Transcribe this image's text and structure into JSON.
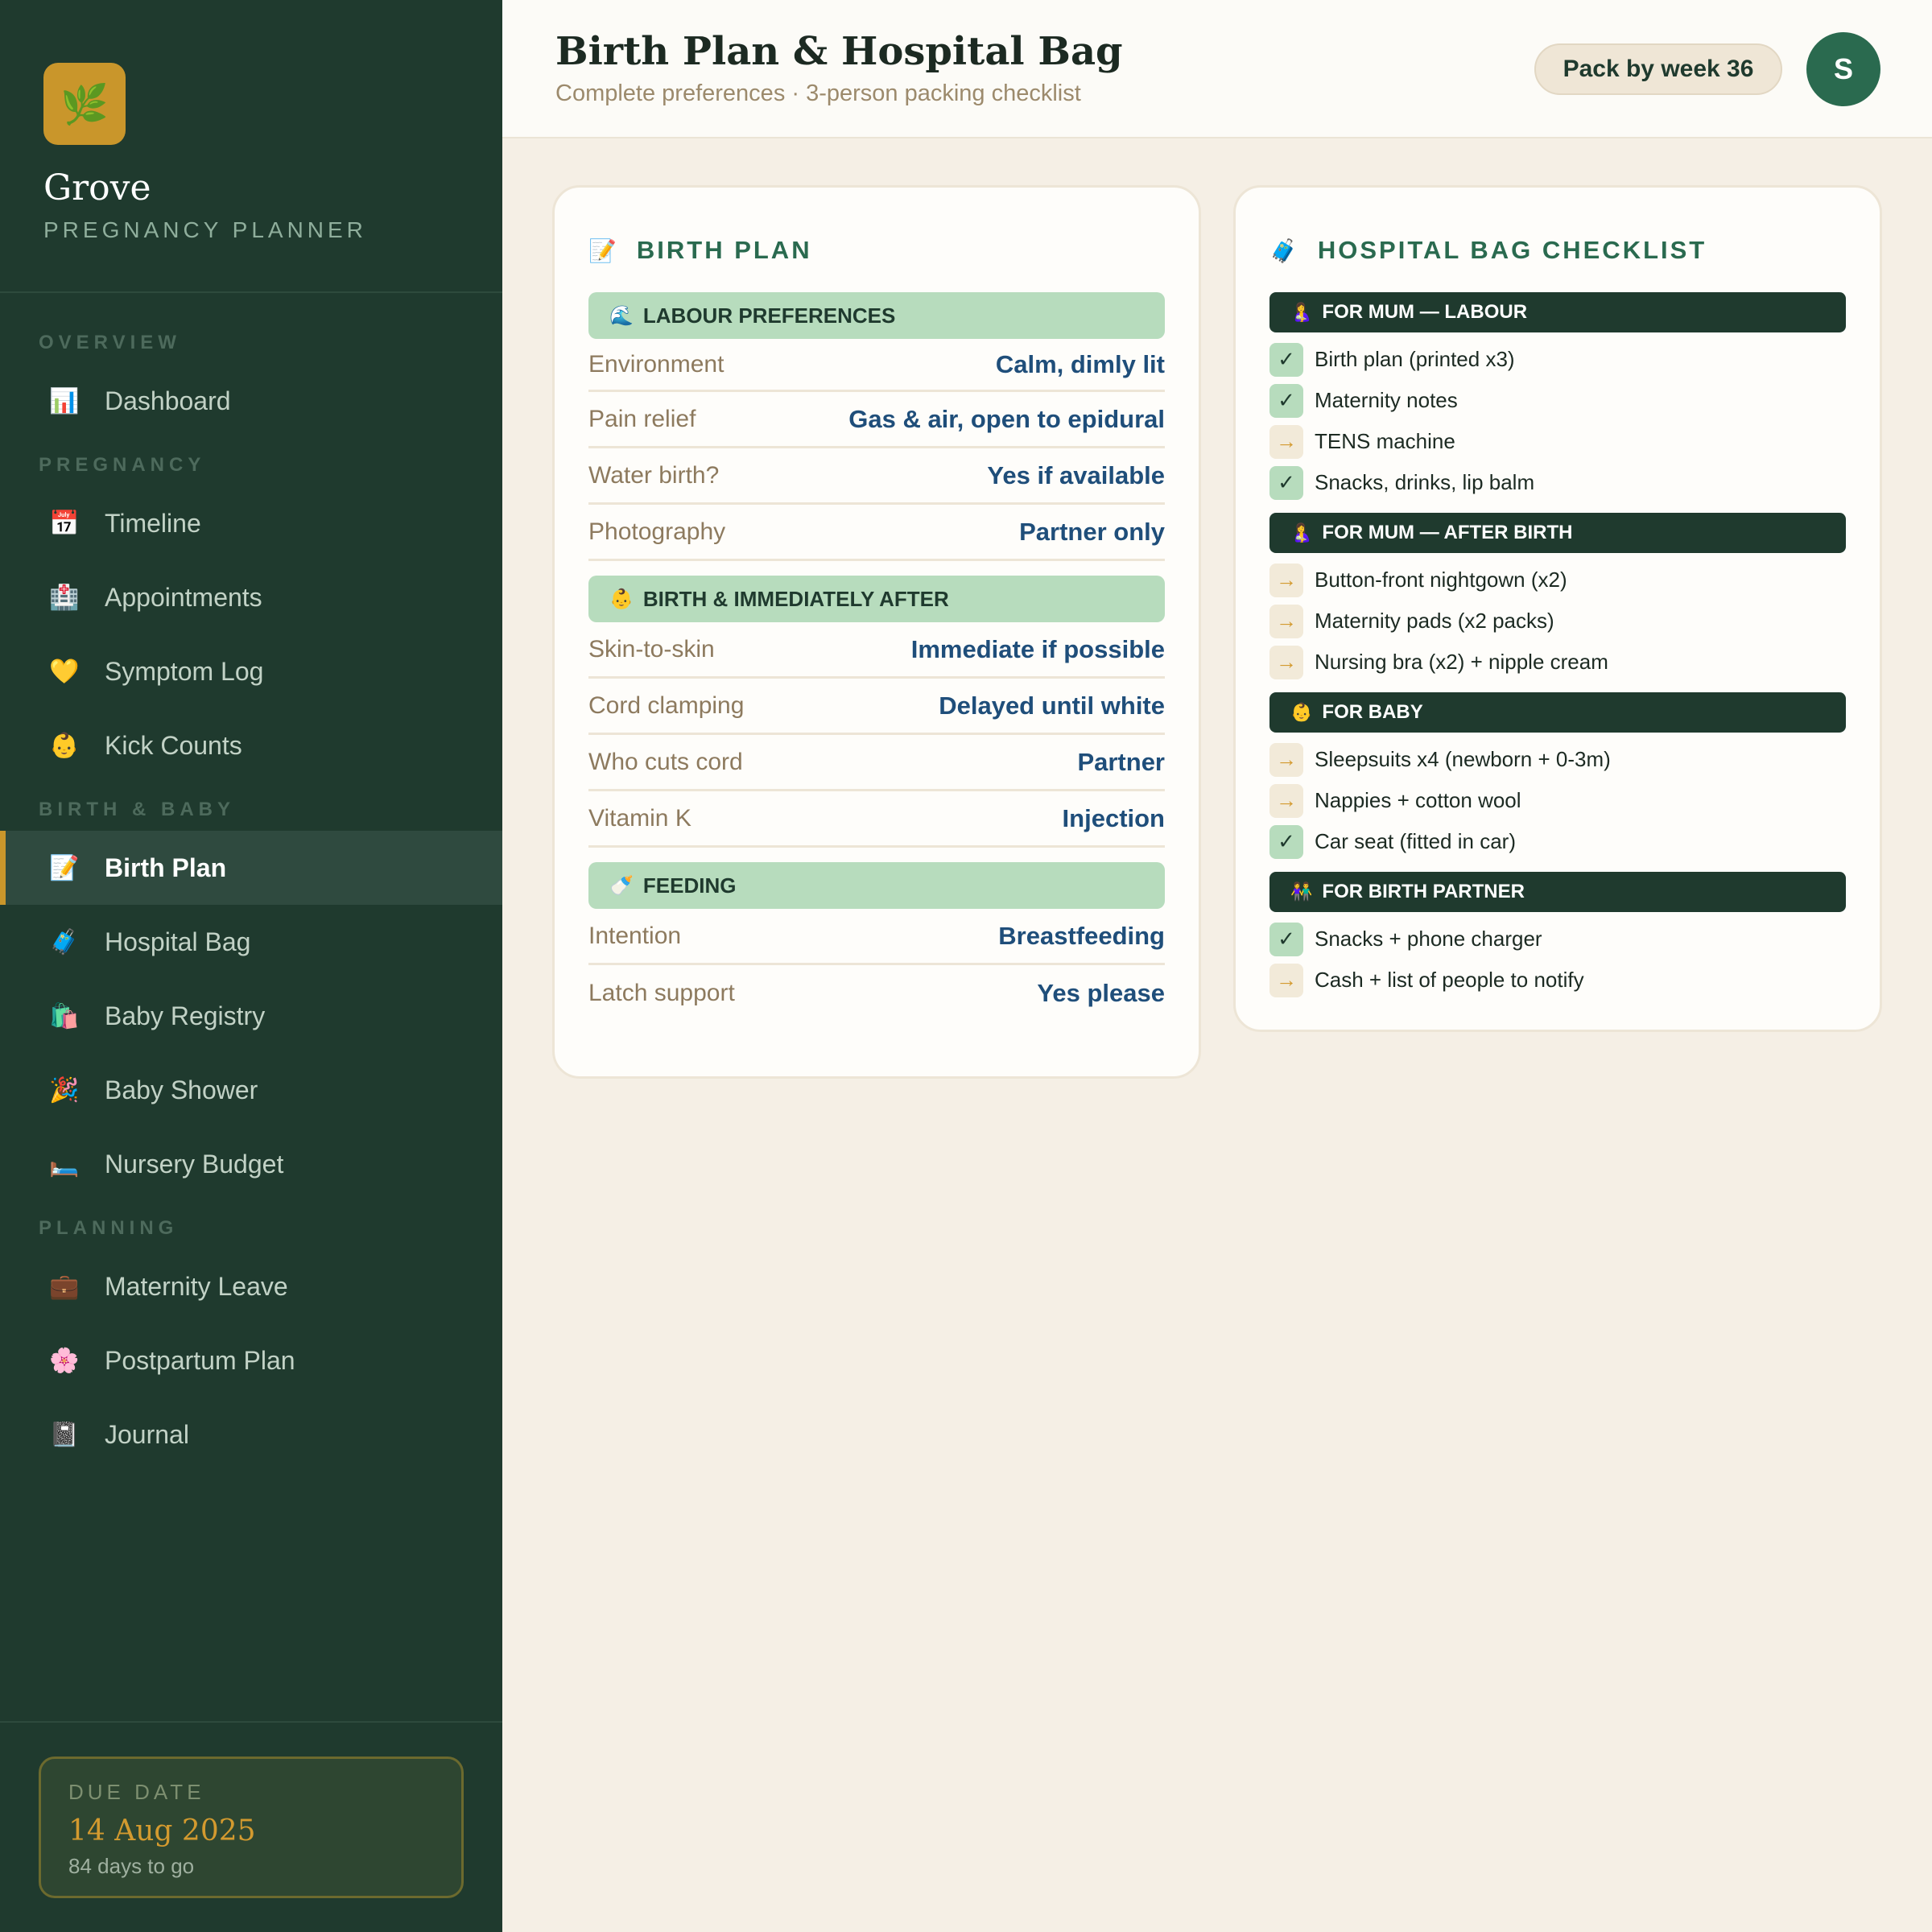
{
  "brand": {
    "name": "Grove",
    "subtitle": "PREGNANCY PLANNER",
    "logo_icon": "🌿"
  },
  "nav": {
    "overview_label": "OVERVIEW",
    "pregnancy_label": "PREGNANCY",
    "birth_baby_label": "BIRTH & BABY",
    "planning_label": "PLANNING",
    "items": [
      {
        "label": "Dashboard",
        "icon": "📊"
      },
      {
        "label": "Timeline",
        "icon": "📅"
      },
      {
        "label": "Appointments",
        "icon": "🏥"
      },
      {
        "label": "Symptom Log",
        "icon": "💛"
      },
      {
        "label": "Kick Counts",
        "icon": "👶"
      },
      {
        "label": "Birth Plan",
        "icon": "📝",
        "active": true
      },
      {
        "label": "Hospital Bag",
        "icon": "🧳"
      },
      {
        "label": "Baby Registry",
        "icon": "🛍️"
      },
      {
        "label": "Baby Shower",
        "icon": "🎉"
      },
      {
        "label": "Nursery Budget",
        "icon": "🛏️"
      },
      {
        "label": "Maternity Leave",
        "icon": "💼"
      },
      {
        "label": "Postpartum Plan",
        "icon": "🌸"
      },
      {
        "label": "Journal",
        "icon": "📓"
      }
    ]
  },
  "due": {
    "label": "DUE DATE",
    "date": "14 Aug 2025",
    "remaining": "84 days to go"
  },
  "header": {
    "title": "Birth Plan & Hospital Bag",
    "subtitle": "Complete preferences · 3-person packing checklist",
    "pack_badge": "Pack by week 36",
    "avatar_initial": "S"
  },
  "birth_plan": {
    "title": "BIRTH PLAN",
    "icon": "📝",
    "sections": [
      {
        "title": "LABOUR PREFERENCES",
        "icon": "🌊",
        "rows": [
          {
            "label": "Environment",
            "value": "Calm, dimly lit"
          },
          {
            "label": "Pain relief",
            "value": "Gas & air, open to epidural"
          },
          {
            "label": "Water birth?",
            "value": "Yes if available"
          },
          {
            "label": "Photography",
            "value": "Partner only"
          }
        ]
      },
      {
        "title": "BIRTH & IMMEDIATELY AFTER",
        "icon": "👶",
        "rows": [
          {
            "label": "Skin-to-skin",
            "value": "Immediate if possible"
          },
          {
            "label": "Cord clamping",
            "value": "Delayed until white"
          },
          {
            "label": "Who cuts cord",
            "value": "Partner"
          },
          {
            "label": "Vitamin K",
            "value": "Injection"
          }
        ]
      },
      {
        "title": "FEEDING",
        "icon": "🍼",
        "rows": [
          {
            "label": "Intention",
            "value": "Breastfeeding"
          },
          {
            "label": "Latch support",
            "value": "Yes please"
          }
        ]
      }
    ]
  },
  "hospital_bag": {
    "title": "HOSPITAL BAG CHECKLIST",
    "icon": "🧳",
    "check_mark": "✓",
    "todo_mark": "→",
    "groups": [
      {
        "title": "FOR MUM — LABOUR",
        "icon": "🤱",
        "items": [
          {
            "label": "Birth plan (printed x3)",
            "done": true
          },
          {
            "label": "Maternity notes",
            "done": true
          },
          {
            "label": "TENS machine",
            "done": false
          },
          {
            "label": "Snacks, drinks, lip balm",
            "done": true
          }
        ]
      },
      {
        "title": "FOR MUM — AFTER BIRTH",
        "icon": "🤱",
        "items": [
          {
            "label": "Button-front nightgown (x2)",
            "done": false
          },
          {
            "label": "Maternity pads (x2 packs)",
            "done": false
          },
          {
            "label": "Nursing bra (x2) + nipple cream",
            "done": false
          }
        ]
      },
      {
        "title": "FOR BABY",
        "icon": "👶",
        "items": [
          {
            "label": "Sleepsuits x4 (newborn + 0-3m)",
            "done": false
          },
          {
            "label": "Nappies + cotton wool",
            "done": false
          },
          {
            "label": "Car seat (fitted in car)",
            "done": true
          }
        ]
      },
      {
        "title": "FOR BIRTH PARTNER",
        "icon": "👫",
        "items": [
          {
            "label": "Snacks + phone charger",
            "done": true
          },
          {
            "label": "Cash + list of people to notify",
            "done": false
          }
        ]
      }
    ]
  },
  "colors": {
    "sidebar_bg": "#1f3a2e",
    "accent_gold": "#c9962b",
    "primary_green": "#2a6a4f",
    "section_mint": "#b7dcbd",
    "value_blue": "#1f4e7a",
    "page_bg": "#f5efe5"
  }
}
